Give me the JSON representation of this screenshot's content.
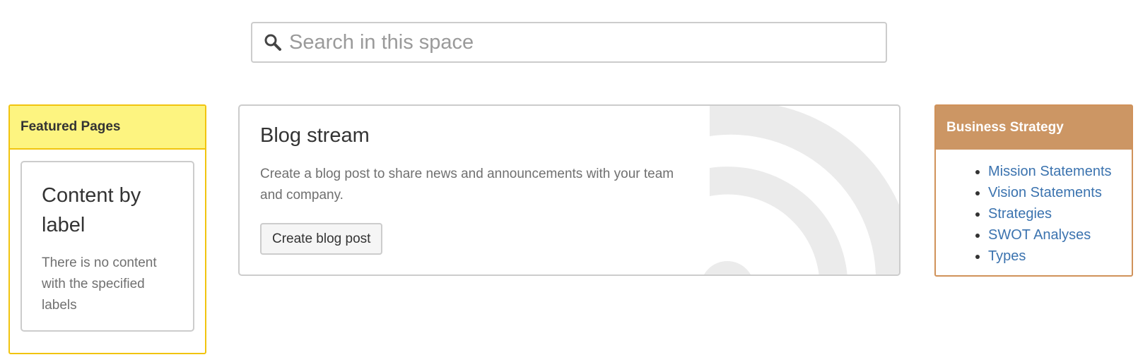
{
  "search": {
    "placeholder": "Search in this space"
  },
  "featured": {
    "title": "Featured Pages",
    "card_title": "Content by label",
    "card_text": "There is no content with the specified labels"
  },
  "blog": {
    "title": "Blog stream",
    "description": "Create a blog post to share news and announcements with your team and company.",
    "button_label": "Create blog post"
  },
  "strategy": {
    "title": "Business Strategy",
    "links": [
      {
        "label": "Mission Statements"
      },
      {
        "label": "Vision Statements"
      },
      {
        "label": "Strategies"
      },
      {
        "label": "SWOT Analyses"
      },
      {
        "label": "Types"
      }
    ]
  },
  "colors": {
    "featured_header_bg": "#fdf480",
    "featured_border": "#f1c40f",
    "strategy_header_bg": "#cc9664",
    "link": "#3b73af"
  },
  "icons": {
    "search": "search-icon",
    "rss": "rss-icon"
  }
}
